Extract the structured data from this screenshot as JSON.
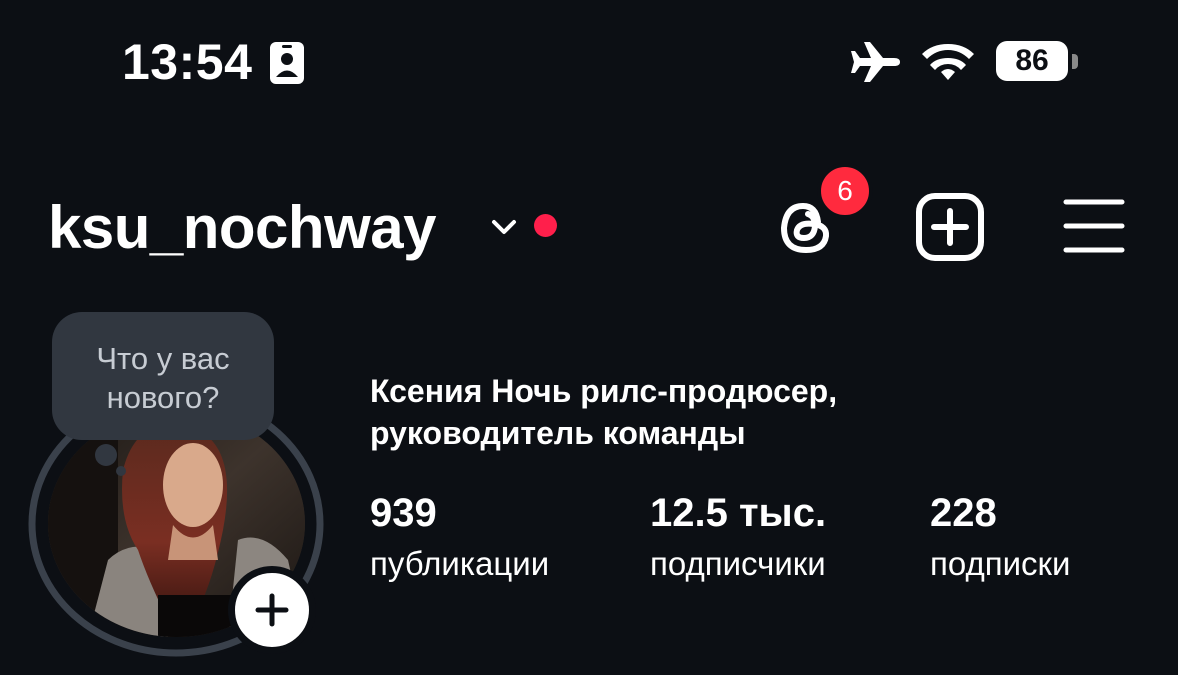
{
  "status_bar": {
    "time": "13:54",
    "battery": "86",
    "icons": [
      "id-card-icon",
      "airplane-icon",
      "wifi-icon",
      "battery-icon"
    ]
  },
  "header": {
    "username": "ksu_nochway",
    "notifications_count": "6",
    "icons": [
      "chevron-down-icon",
      "threads-icon",
      "create-post-icon",
      "menu-icon"
    ],
    "accent_color": "#ff1f4b"
  },
  "profile": {
    "note": {
      "line1": "Что у вас",
      "line2": "нового?"
    },
    "bio_line1": "Ксения Ночь рилс-продюсер,",
    "bio_line2": "руководитель команды",
    "stats": [
      {
        "value": "939",
        "label": "публикации"
      },
      {
        "value": "12.5 тыс.",
        "label": "подписчики"
      },
      {
        "value": "228",
        "label": "подписки"
      }
    ]
  }
}
